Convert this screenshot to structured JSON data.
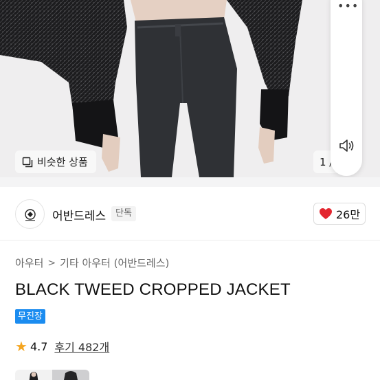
{
  "hero": {
    "similar_button_label": "비슷한 상품",
    "page_indicator": "1 /",
    "more_icon": "more-dots-icon",
    "speaker_icon": "speaker-icon"
  },
  "seller": {
    "name": "어반드레스",
    "badge": "단독",
    "like_count": "26만",
    "like_icon": "heart-icon",
    "like_color": "#e3262f"
  },
  "breadcrumb": {
    "items": [
      "아우터",
      "기타 아우터 (어반드레스)"
    ]
  },
  "product": {
    "title": "BLACK TWEED CROPPED JACKET",
    "shipping_badge": "무진장",
    "shipping_badge_color": "#1b8cf0",
    "rating": "4.7",
    "reviews_label": "후기 482개",
    "star_color": "#f4a521"
  }
}
